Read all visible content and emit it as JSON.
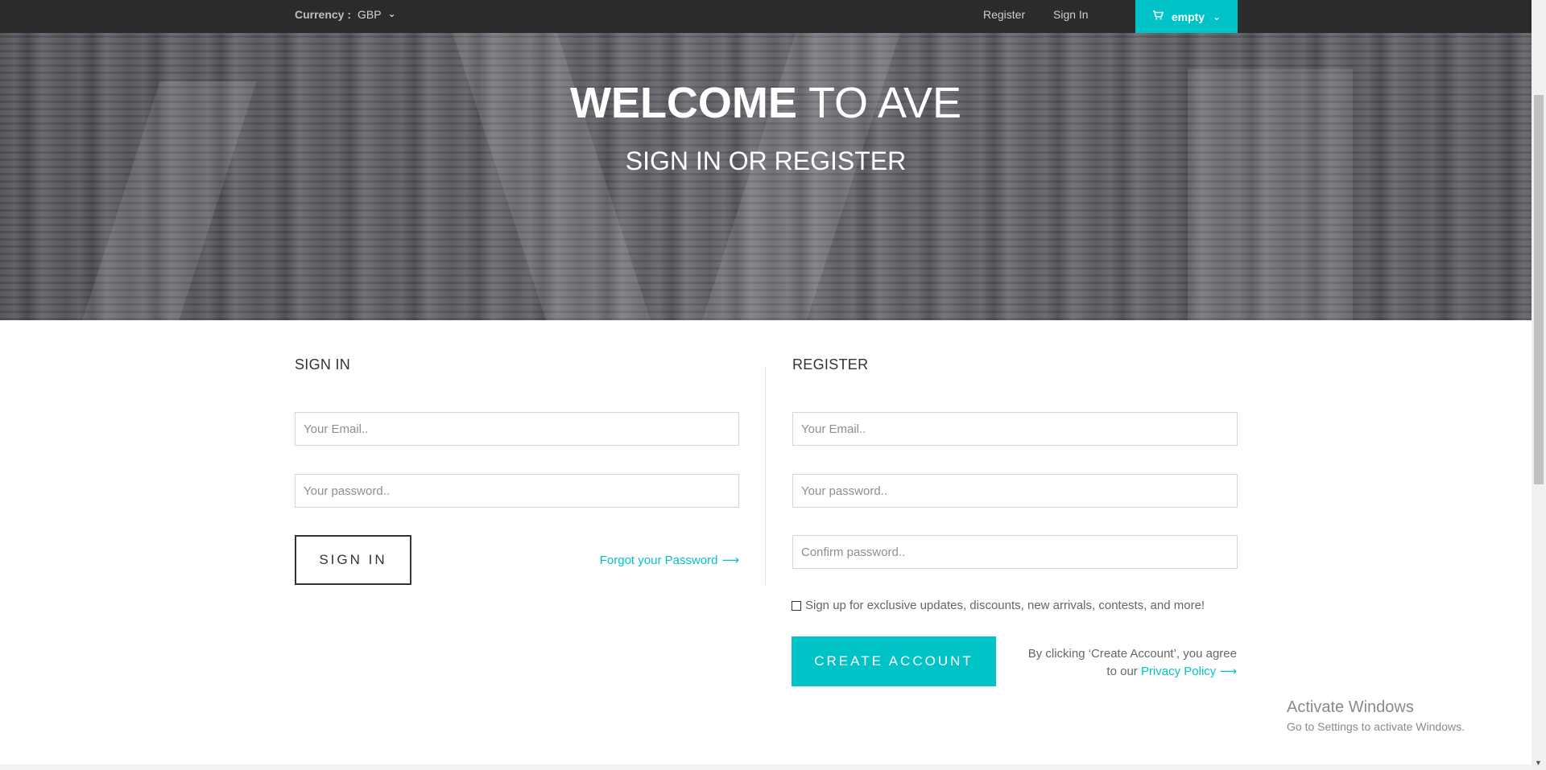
{
  "topbar": {
    "currency_label": "Currency :",
    "currency_value": "GBP",
    "register": "Register",
    "sign_in": "Sign In",
    "cart_label": "empty"
  },
  "hero": {
    "title_bold": "WELCOME",
    "title_rest": " TO AVE",
    "subtitle": "SIGN IN OR REGISTER"
  },
  "signin": {
    "title": "SIGN IN",
    "email_placeholder": "Your Email..",
    "password_placeholder": "Your password..",
    "button": "SIGN IN",
    "forgot": "Forgot your Password"
  },
  "register": {
    "title": "REGISTER",
    "email_placeholder": "Your Email..",
    "password_placeholder": "Your password..",
    "confirm_placeholder": "Confirm password..",
    "newsletter": "Sign up for exclusive updates, discounts, new arrivals, contests, and more!",
    "button": "CREATE ACCOUNT",
    "agree_line1": "By clicking ‘Create Account’, you agree",
    "agree_prefix": "to our ",
    "privacy": "Privacy Policy"
  },
  "os_watermark": {
    "line1": "Activate Windows",
    "line2": "Go to Settings to activate Windows."
  },
  "colors": {
    "accent": "#00c3c8",
    "topbar": "#2b2b2b"
  },
  "icons": {
    "cart": "cart-icon",
    "chevron": "chevron-down-icon",
    "arrow": "arrow-right-icon"
  }
}
